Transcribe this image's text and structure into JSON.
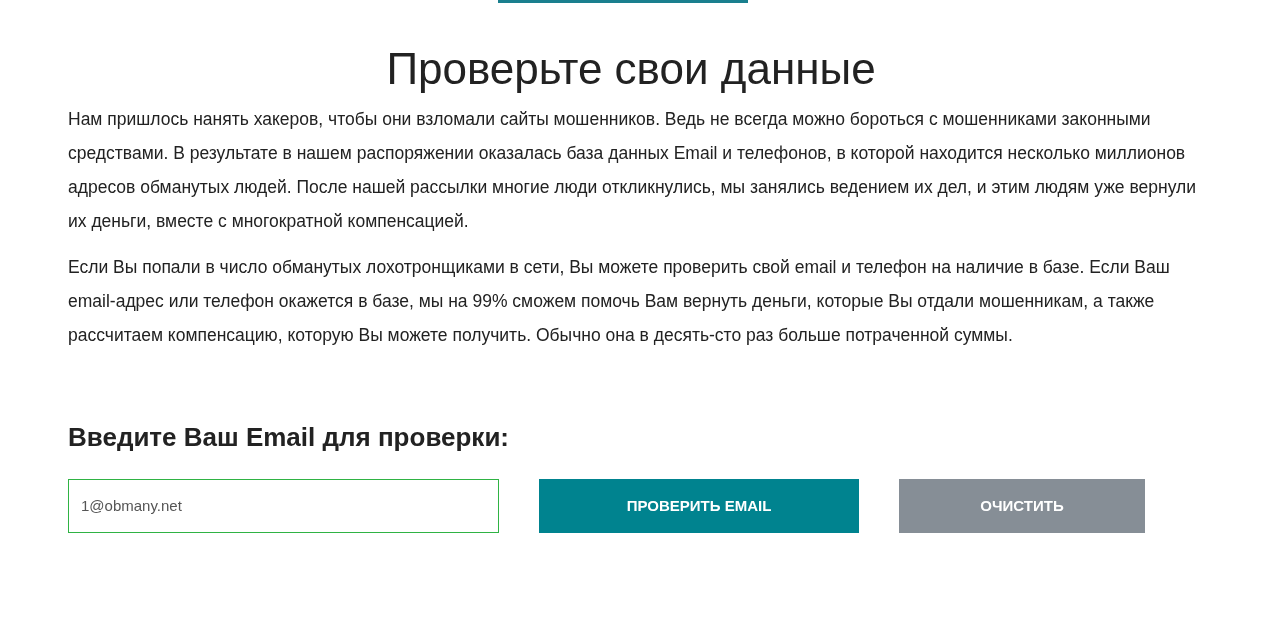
{
  "title": "Проверьте свои данные",
  "paragraphs": [
    "Нам пришлось нанять хакеров, чтобы они взломали сайты мошенников. Ведь не всегда можно бороться с мошенниками законными средствами. В результате в нашем распоряжении оказалась база данных Email и телефонов, в которой находится несколько миллионов адресов обманутых людей. После нашей рассылки многие люди откликнулись, мы занялись ведением их дел, и этим людям уже вернули их деньги, вместе с многократной компенсацией.",
    "Если Вы попали в число обманутых лохотронщиками в сети, Вы можете проверить свой email и телефон на наличие в базе. Если Ваш email-адрес или телефон окажется в базе, мы на 99% сможем помочь Вам вернуть деньги, которые Вы отдали мошенникам, а также рассчитаем компенсацию, которую Вы можете получить. Обычно она в десять-сто раз больше потраченной суммы."
  ],
  "form": {
    "heading": "Введите Ваш Email для проверки:",
    "email": {
      "value": "1@obmany.net"
    },
    "buttons": [
      {
        "label": "ПРОВЕРИТЬ EMAIL",
        "kind": "primary"
      },
      {
        "label": "ОЧИСТИТЬ",
        "kind": "secondary"
      }
    ]
  }
}
